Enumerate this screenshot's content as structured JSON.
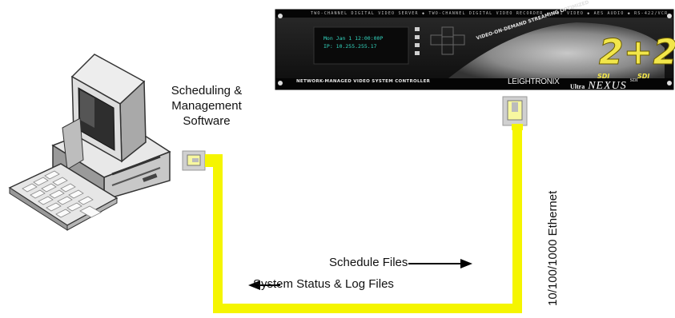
{
  "device": {
    "top_banner": "TWO-CHANNEL DIGITAL VIDEO SERVER ◆ TWO-CHANNEL DIGITAL VIDEO RECORDER ◆ SDI VIDEO ◆ AES AUDIO ◆ RS-422/VCR CONTROLLER ◆ MESSAGING SYSTEM",
    "display_line1": "Mon Jan 1 12:00:00P",
    "display_line2": "IP: 10.255.255.17",
    "arc_text": "VIDEO-ON-DEMAND STREAMING OPTIMIZED",
    "badge_big": "2+2",
    "badge_left": "SDI",
    "badge_right": "SDI",
    "bottom_left": "NETWORK-MANAGED VIDEO SYSTEM CONTROLLER",
    "brand": "LEIGHTRONIX",
    "model_prefix": "Ultra",
    "model_name": "NEXUS",
    "model_suffix": "SDI"
  },
  "labels": {
    "software_line1": "Scheduling &",
    "software_line2": "Management",
    "software_line3": "Software",
    "schedule_files": "Schedule Files",
    "status_files": "System Status & Log Files",
    "ethernet": "10/100/1000 Ethernet"
  },
  "colors": {
    "cable": "#f5f500",
    "panel": "#1a1a1a",
    "display_text": "#33d6c0",
    "badge": "#f2e64a"
  }
}
